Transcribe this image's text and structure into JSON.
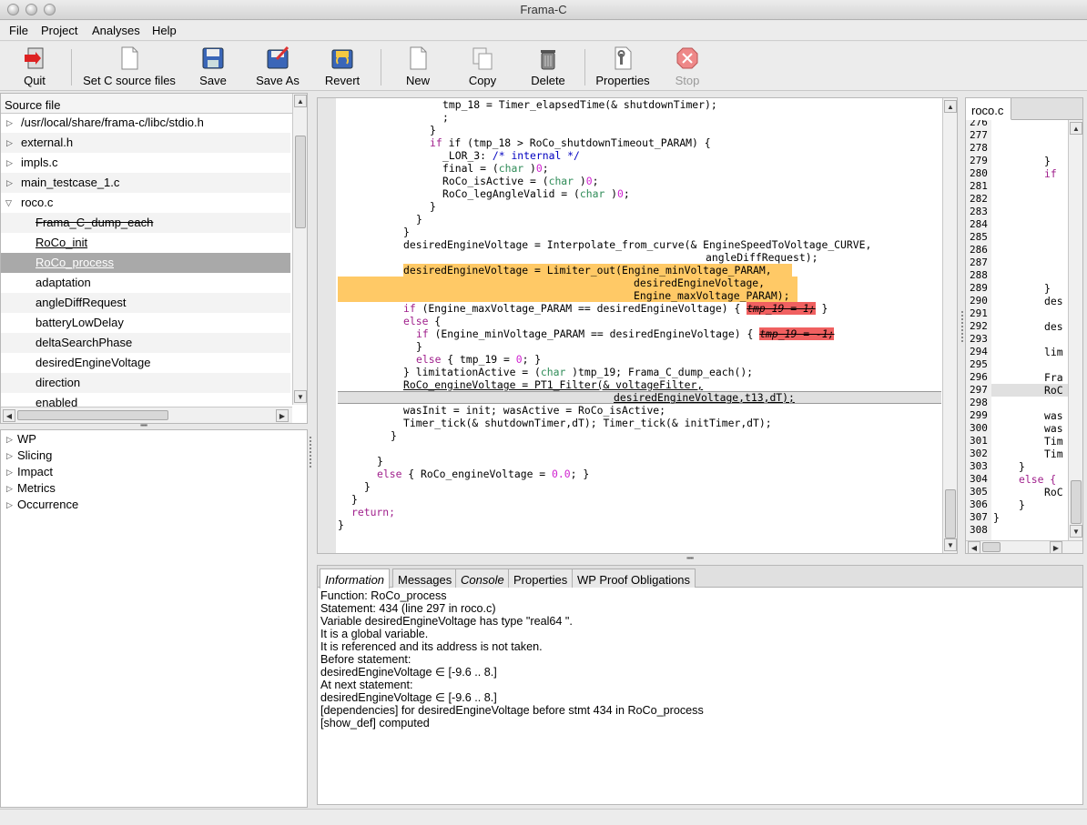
{
  "window": {
    "title": "Frama-C"
  },
  "menu": [
    "File",
    "Project",
    "Analyses",
    "Help"
  ],
  "toolbar": {
    "quit": "Quit",
    "set_c_source": "Set C source files",
    "save": "Save",
    "save_as": "Save As",
    "revert": "Revert",
    "new": "New",
    "copy": "Copy",
    "delete": "Delete",
    "properties": "Properties",
    "stop": "Stop"
  },
  "source_tree": {
    "header": "Source file",
    "rows": [
      "/usr/local/share/frama-c/libc/stdio.h",
      "external.h",
      "impls.c",
      "main_testcase_1.c",
      "roco.c",
      "Frama_C_dump_each",
      "RoCo_init",
      "RoCo_process",
      "adaptation",
      "angleDiffRequest",
      "batteryLowDelay",
      "deltaSearchPhase",
      "desiredEngineVoltage",
      "direction",
      "enabled"
    ]
  },
  "plugins": [
    "WP",
    "Slicing",
    "Impact",
    "Metrics",
    "Occurrence"
  ],
  "code": [
    "tmp_18 = Timer_elapsedTime(& shutdownTimer);",
    ";",
    "}",
    "if (tmp_18 > RoCo_shutdownTimeout_PARAM) {",
    "_LOR_3: /* internal */",
    "final = (char )0;",
    "RoCo_isActive = (char )0;",
    "RoCo_legAngleValid = (char )0;",
    "}",
    "}",
    "}",
    "desiredEngineVoltage = Interpolate_from_curve(& EngineSpeedToVoltage_CURVE,",
    "angleDiffRequest);",
    "desiredEngineVoltage = Limiter_out(Engine_minVoltage_PARAM,",
    "desiredEngineVoltage,",
    "Engine_maxVoltage_PARAM);",
    "if (Engine_maxVoltage_PARAM == desiredEngineVoltage) {",
    "tmp_19 = 1;",
    "}",
    "else {",
    "if (Engine_minVoltage_PARAM == desiredEngineVoltage) {",
    "tmp_19 = -1;",
    "}",
    "else { tmp_19 = 0; }",
    "} limitationActive = (char )tmp_19; Frama_C_dump_each();",
    "RoCo_engineVoltage = PT1_Filter(& voltageFilter,",
    "desiredEngineVoltage,t13,dT);",
    "wasInit = init; wasActive = RoCo_isActive;",
    "Timer_tick(& shutdownTimer,dT); Timer_tick(& initTimer,dT);",
    "}",
    "}",
    "else { RoCo_engineVoltage = 0.0; }",
    "}",
    "}",
    "return;",
    "}"
  ],
  "right_pane": {
    "tab": "roco.c",
    "line_numbers": [
      "276",
      "277",
      "278",
      "279",
      "280",
      "281",
      "282",
      "283",
      "284",
      "285",
      "286",
      "287",
      "288",
      "289",
      "290",
      "291",
      "292",
      "293",
      "294",
      "295",
      "296",
      "297",
      "298",
      "299",
      "300",
      "301",
      "302",
      "303",
      "304",
      "305",
      "306",
      "307",
      "308"
    ],
    "snippets": [
      "}",
      "if",
      "}",
      "des",
      "des",
      "lim",
      "Fra",
      "RoC",
      "was",
      "was",
      "Tim",
      "Tim",
      "}",
      "else {",
      "RoC",
      "}",
      "}"
    ]
  },
  "info_tabs": [
    "Information",
    "Messages",
    "Console",
    "Properties",
    "WP Proof Obligations"
  ],
  "info_lines": [
    "Function: RoCo_process",
    "Statement: 434 (line 297 in roco.c)",
    "Variable desiredEngineVoltage has type \"real64 \".",
    "It is a global variable.",
    "It is referenced and its address is not taken.",
    "Before statement:",
    "desiredEngineVoltage ∈ [-9.6 .. 8.]",
    "At next statement:",
    "desiredEngineVoltage ∈ [-9.6 .. 8.]",
    "[dependencies] for desiredEngineVoltage before stmt 434 in RoCo_process",
    "[show_def] computed"
  ]
}
